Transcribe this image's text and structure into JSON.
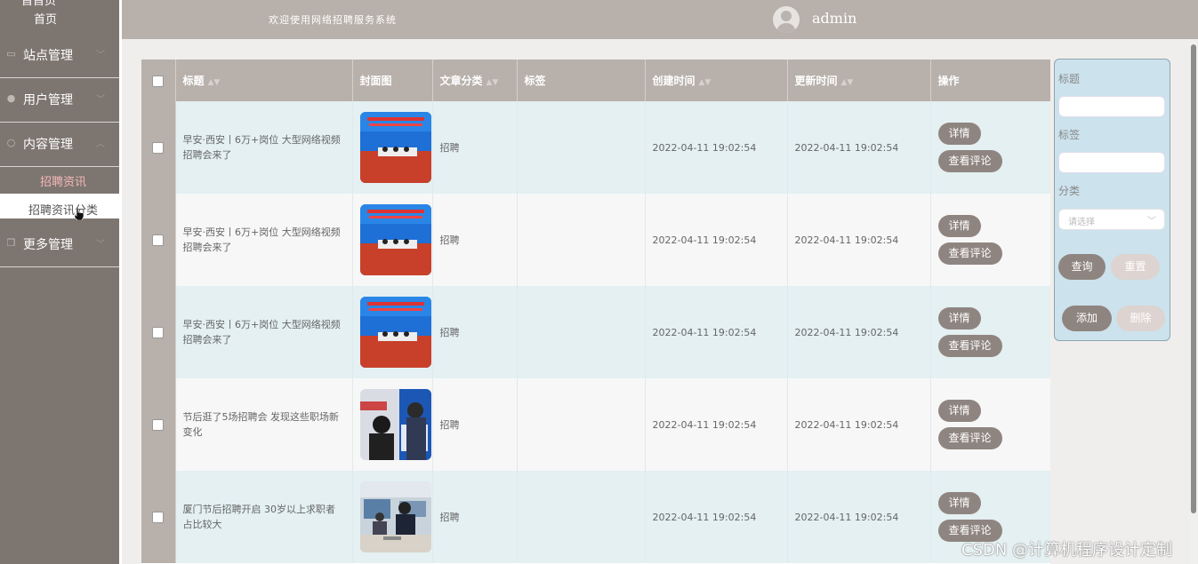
{
  "sidebar": {
    "brand": "首首页",
    "home": "首页",
    "groups": [
      {
        "label": "站点管理",
        "icon": "monitor-icon"
      },
      {
        "label": "用户管理",
        "icon": "user-icon"
      },
      {
        "label": "内容管理",
        "icon": "chat-icon"
      },
      {
        "label": "更多管理",
        "icon": "copy-icon"
      }
    ],
    "sub_active": "招聘资讯",
    "sub_item": "招聘资讯分类"
  },
  "header": {
    "welcome": "欢迎使用网络招聘服务系统",
    "username": "admin"
  },
  "table": {
    "headers": {
      "title": "标题",
      "cover": "封面图",
      "category": "文章分类",
      "tags": "标签",
      "created": "创建时间",
      "updated": "更新时间",
      "actions": "操作"
    },
    "detail_label": "详情",
    "comment_label": "查看评论",
    "rows": [
      {
        "title": "早安·西安丨6万+岗位 大型网络视频招聘会来了",
        "category": "招聘",
        "tags": "",
        "created": "2022-04-11 19:02:54",
        "updated": "2022-04-11 19:02:54"
      },
      {
        "title": "早安·西安丨6万+岗位 大型网络视频招聘会来了",
        "category": "招聘",
        "tags": "",
        "created": "2022-04-11 19:02:54",
        "updated": "2022-04-11 19:02:54"
      },
      {
        "title": "早安·西安丨6万+岗位 大型网络视频招聘会来了",
        "category": "招聘",
        "tags": "",
        "created": "2022-04-11 19:02:54",
        "updated": "2022-04-11 19:02:54"
      },
      {
        "title": "节后逛了5场招聘会 发现这些职场新变化",
        "category": "招聘",
        "tags": "",
        "created": "2022-04-11 19:02:54",
        "updated": "2022-04-11 19:02:54"
      },
      {
        "title": "厦门节后招聘开启 30岁以上求职者占比较大",
        "category": "招聘",
        "tags": "",
        "created": "2022-04-11 19:02:54",
        "updated": "2022-04-11 19:02:54"
      }
    ]
  },
  "search": {
    "title_label": "标题",
    "tag_label": "标签",
    "category_label": "分类",
    "category_placeholder": "请选择",
    "query_label": "查询",
    "reset_label": "重置",
    "add_label": "添加",
    "delete_label": "删除"
  },
  "watermark": "CSDN @计算机程序设计定制"
}
